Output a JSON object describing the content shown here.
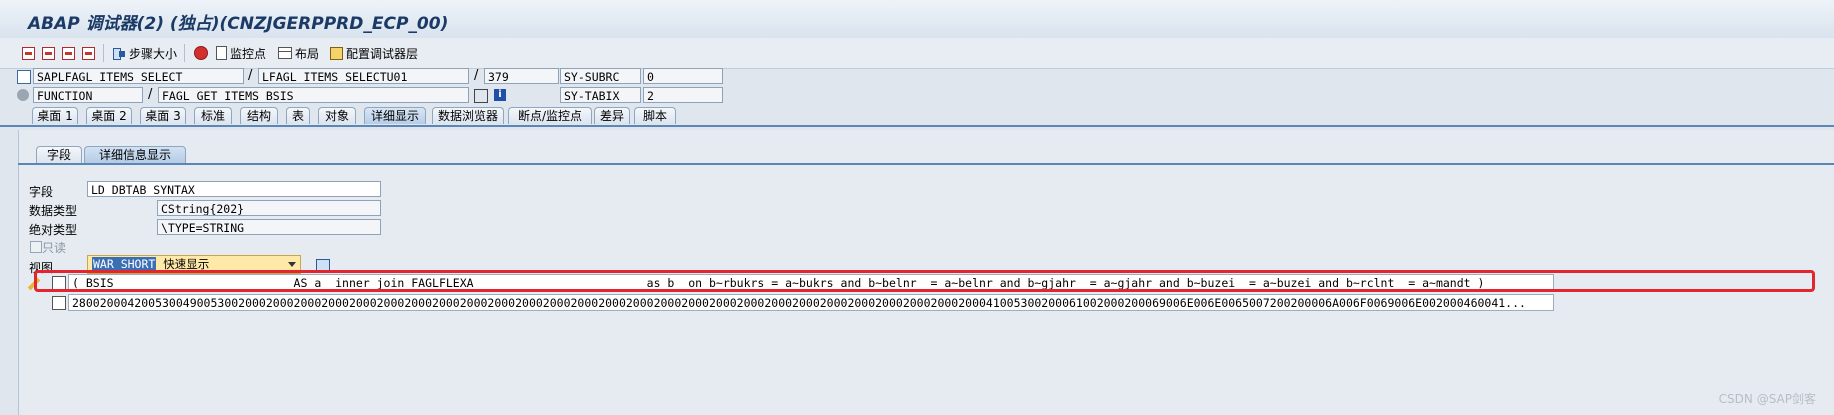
{
  "window": {
    "title": "ABAP 调试器(2) (独占)(CNZJGERPPRD_ECP_00)"
  },
  "toolbar": {
    "step_size": "步骤大小",
    "watchpoint": "监控点",
    "layout": "布局",
    "configure": "配置调试器层"
  },
  "context": {
    "program": "SAPLFAGL_ITEMS_SELECT",
    "include": "LFAGL_ITEMS_SELECTU01",
    "line": "379",
    "subrc_label": "SY-SUBRC",
    "subrc_value": "0",
    "event_type": "FUNCTION",
    "event_name": "FAGL_GET_ITEMS_BSIS",
    "tabix_label": "SY-TABIX",
    "tabix_value": "2"
  },
  "tabs": [
    "桌面 1",
    "桌面 2",
    "桌面 3",
    "标准",
    "结构",
    "表",
    "对象",
    "详细显示",
    "数据浏览器",
    "断点/监控点",
    "差异",
    "脚本"
  ],
  "subtabs": [
    "字段",
    "详细信息显示"
  ],
  "detail": {
    "field_label": "字段",
    "field_value": "LD_DBTAB_SYNTAX",
    "datatype_label": "数据类型",
    "datatype_value": "CString{202}",
    "abstype_label": "绝对类型",
    "abstype_value": "\\TYPE=STRING",
    "readonly_label": "只读",
    "view_label": "视图",
    "view_value_selected": "WAR_SHORT",
    "view_value_rest": " 快速显示"
  },
  "output": {
    "text_line": "( BSIS                          AS a  inner join FAGLFLEXA                         as b  on b~rbukrs = a~bukrs and b~belnr  = a~belnr and b~gjahr  = a~gjahr and b~buzei  = a~buzei and b~rclnt  = a~mandt )",
    "hex_line": "28002000420053004900530020002000200020002000200020002000200020002000200020002000200020002000200020002000200020002000200020002000200041005300200061002000200069006E006E0065007200200006A006F0069006E002000460041..."
  },
  "watermark": "CSDN @SAP剑客"
}
